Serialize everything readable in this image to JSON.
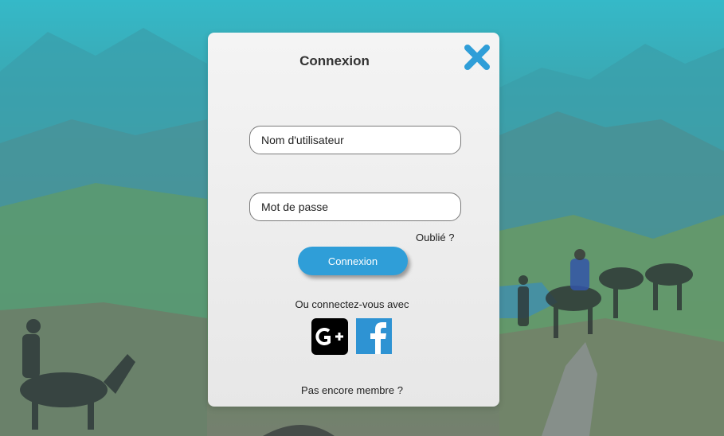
{
  "modal": {
    "title": "Connexion",
    "close_icon": "close-x-icon",
    "username": {
      "placeholder": "Nom d'utilisateur",
      "value": ""
    },
    "password": {
      "placeholder": "Mot de passe",
      "value": ""
    },
    "forgot_label": "Oublié ?",
    "login_label": "Connexion",
    "social_label": "Ou connectez-vous avec",
    "social": [
      {
        "name": "google-plus",
        "icon": "google-plus-icon",
        "text": "G+"
      },
      {
        "name": "facebook",
        "icon": "facebook-icon",
        "text": "f"
      }
    ],
    "register_label": "Pas encore membre ?"
  },
  "colors": {
    "accent": "#2f9ed8",
    "close": "#2f9ed8",
    "facebook": "#2e93d3",
    "google": "#000000"
  }
}
